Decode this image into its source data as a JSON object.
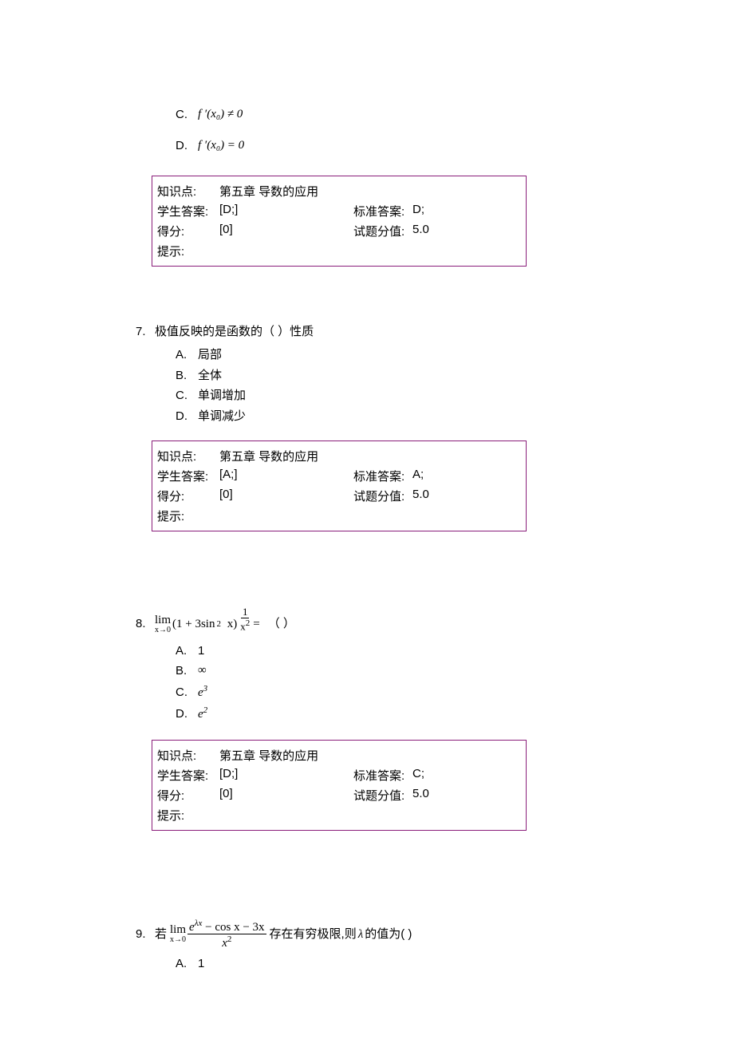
{
  "q6": {
    "opt_c_letter": "C.",
    "opt_c_text": "f ′(x₀) ≠ 0",
    "opt_d_letter": "D.",
    "opt_d_text": "f ′(x₀) = 0",
    "box": {
      "kp_label": "知识点:",
      "kp_value": "第五章 导数的应用",
      "sa_label": "学生答案:",
      "sa_value": "[D;]",
      "std_label": "标准答案:",
      "std_value": "D;",
      "score_label": "得分:",
      "score_value": "[0]",
      "pts_label": "试题分值:",
      "pts_value": "5.0",
      "hint_label": "提示:"
    }
  },
  "q7": {
    "num": "7.",
    "stem": "极值反映的是函数的（    ）性质",
    "opts": {
      "a_l": "A.",
      "a_t": "局部",
      "b_l": "B.",
      "b_t": "全体",
      "c_l": "C.",
      "c_t": "单调增加",
      "d_l": "D.",
      "d_t": "单调减少"
    },
    "box": {
      "kp_label": "知识点:",
      "kp_value": "第五章 导数的应用",
      "sa_label": "学生答案:",
      "sa_value": "[A;]",
      "std_label": "标准答案:",
      "std_value": "A;",
      "score_label": "得分:",
      "score_value": "[0]",
      "pts_label": "试题分值:",
      "pts_value": "5.0",
      "hint_label": "提示:"
    }
  },
  "q8": {
    "num": "8.",
    "lim_top": "lim",
    "lim_bot": "x→0",
    "body": "(1 + 3sin",
    "body2": "x)",
    "exp_num": "1",
    "exp_den": "x",
    "eq": "=",
    "paren": "（    ）",
    "opts": {
      "a_l": "A.",
      "a_t": "1",
      "b_l": "B.",
      "b_t": "∞",
      "c_l": "C.",
      "c_t": "e",
      "c_sup": "3",
      "d_l": "D.",
      "d_t": "e",
      "d_sup": "2"
    },
    "box": {
      "kp_label": "知识点:",
      "kp_value": "第五章 导数的应用",
      "sa_label": "学生答案:",
      "sa_value": "[D;]",
      "std_label": "标准答案:",
      "std_value": "C;",
      "score_label": "得分:",
      "score_value": "[0]",
      "pts_label": "试题分值:",
      "pts_value": "5.0",
      "hint_label": "提示:"
    }
  },
  "q9": {
    "num": "9.",
    "prefix": "若",
    "lim_top": "lim",
    "lim_bot": "x→0",
    "frac_num_a": "e",
    "frac_num_sup": "λx",
    "frac_num_b": " − cos x − 3x",
    "frac_den": "x",
    "frac_den_sup": "2",
    "tail_a": " 存在有穷极限,则",
    "lam": "λ",
    "tail_b": " 的值为(  )",
    "opts": {
      "a_l": "A.",
      "a_t": "1"
    }
  }
}
